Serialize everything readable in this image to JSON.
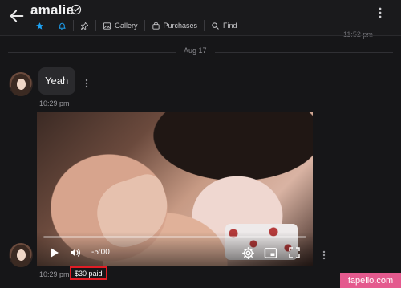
{
  "header": {
    "title": "amalie",
    "toolbar": {
      "gallery_label": "Gallery",
      "purchases_label": "Purchases",
      "find_label": "Find"
    },
    "icons": {
      "back": "arrow-left-icon",
      "verified": "verified-badge-icon",
      "star": "star-icon",
      "bell": "bell-icon",
      "pin": "pin-icon",
      "gallery": "image-icon",
      "purchases": "bag-icon",
      "find": "search-icon",
      "more": "more-vertical-icon"
    },
    "accent_color": "#1da1f2"
  },
  "prev_message_time": "11:52 pm",
  "date_separator": "Aug 17",
  "messages": [
    {
      "text": "Yeah",
      "time": "10:29 pm"
    },
    {
      "type": "video",
      "time": "10:29 pm",
      "price_status": "$30 paid",
      "player": {
        "remaining": "-5:00",
        "progress": 0
      }
    }
  ],
  "watermark": "fapello.com"
}
